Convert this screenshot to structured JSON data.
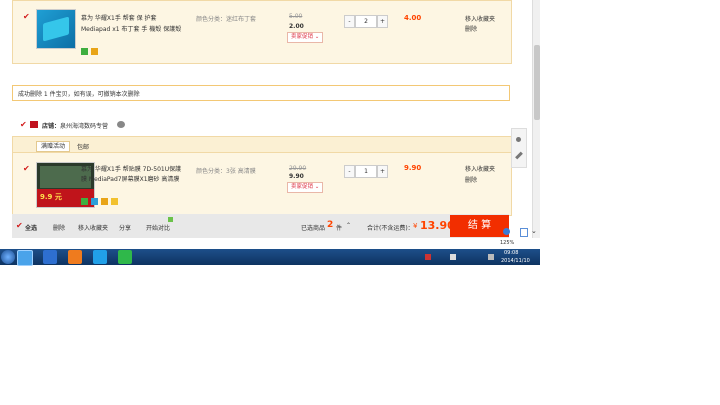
{
  "items": [
    {
      "title_line1": "慕为 华耀X1手 帮套 保 护套",
      "title_line2": "Mediapad x1 布丁套 手 機殼 保護殼",
      "spec": "颜色分类：迷红布丁套",
      "orig_price": "5.00",
      "price": "2.00",
      "promo": "卖家促销",
      "qty": "2",
      "subtotal": "4.00",
      "action_fav": "移入收藏夹",
      "action_del": "删除"
    },
    {
      "title_line1": "慕为 华耀X1手 帮贴膜 7D-501U保護",
      "title_line2": "膜 MediaPad7屏幕膜X1磨砂 高清膜",
      "spec": "颜色分类：3张 高清膜",
      "orig_price": "29.90",
      "price": "9.90",
      "promo": "卖家促销",
      "qty": "1",
      "subtotal": "9.90",
      "action_fav": "移入收藏夹",
      "action_del": "删除",
      "thumb_text": "9.9 元"
    }
  ],
  "notice": "成功删除 1 件宝贝，如有误，可撤销本次删除",
  "shop": {
    "label": "店铺：",
    "name": "泉州海湾数码专营"
  },
  "tabs": [
    "满赠活动",
    "包邮"
  ],
  "bottom": {
    "select_all": "全选",
    "delete": "删除",
    "move_fav": "移入收藏夹",
    "share": "分享",
    "compare": "开始对比",
    "selected_label": "已选商品",
    "selected_count": "2",
    "selected_unit": "件",
    "total_label": "合计(不含运费)：",
    "currency": "¥",
    "total": "13.90",
    "checkout": "结 算"
  },
  "zoom": "125%",
  "clock": {
    "time": "09:08",
    "date": "2014/11/10"
  },
  "colors": {
    "accent": "#ff4400",
    "checkout_bg": "#f22e00",
    "row_bg": "#fdf6e3",
    "taskbar": "#1d4f8a"
  }
}
